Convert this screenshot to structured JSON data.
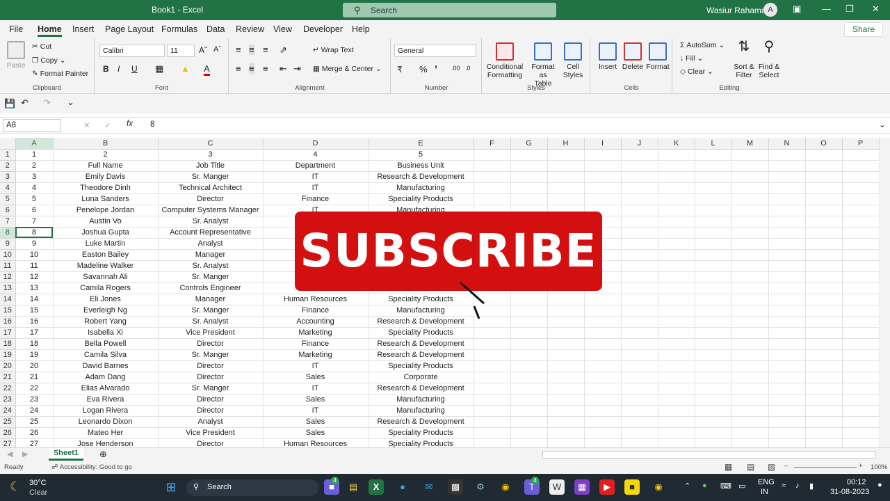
{
  "window": {
    "title": "Book1  -  Excel",
    "search_label": "Search",
    "user_name": "Wasiur Rahaman",
    "avatar_initials": "A"
  },
  "menu": {
    "tabs": [
      "File",
      "Home",
      "Insert",
      "Page Layout",
      "Formulas",
      "Data",
      "Review",
      "View",
      "Developer",
      "Help"
    ],
    "share": "Share"
  },
  "ribbon": {
    "clipboard": {
      "paste": "Paste",
      "cut": "Cut",
      "copy": "Copy",
      "format_painter": "Format Painter",
      "label": "Clipboard"
    },
    "font": {
      "name": "Calibri",
      "size": "11",
      "label": "Font"
    },
    "alignment": {
      "wrap": "Wrap Text",
      "merge": "Merge & Center",
      "label": "Alignment"
    },
    "number": {
      "format": "General",
      "label": "Number"
    },
    "styles": {
      "cond": "Conditional",
      "cond2": "Formatting",
      "fmt": "Format as",
      "fmt2": "Table",
      "cell": "Cell",
      "cell2": "Styles",
      "label": "Styles"
    },
    "cells": {
      "insert": "Insert",
      "delete": "Delete",
      "format": "Format",
      "label": "Cells"
    },
    "editing": {
      "autosum": "AutoSum",
      "fill": "Fill",
      "clear": "Clear",
      "sort": "Sort &",
      "sort2": "Filter",
      "find": "Find &",
      "find2": "Select",
      "label": "Editing"
    }
  },
  "formula_bar": {
    "name_box": "A8",
    "value": "8"
  },
  "columns": [
    "A",
    "B",
    "C",
    "D",
    "E",
    "F",
    "G",
    "H",
    "I",
    "J",
    "K",
    "L",
    "M",
    "N",
    "O",
    "P"
  ],
  "rows": [
    [
      "1",
      "1",
      "2",
      "3",
      "4",
      "5"
    ],
    [
      "2",
      "2",
      "Full Name",
      "Job Title",
      "Department",
      "Business Unit"
    ],
    [
      "3",
      "3",
      "Emily Davis",
      "Sr. Manger",
      "IT",
      "Research & Development"
    ],
    [
      "4",
      "4",
      "Theodore Dinh",
      "Technical Architect",
      "IT",
      "Manufacturing"
    ],
    [
      "5",
      "5",
      "Luna Sanders",
      "Director",
      "Finance",
      "Speciality Products"
    ],
    [
      "6",
      "6",
      "Penelope Jordan",
      "Computer Systems Manager",
      "IT",
      "Manufacturing"
    ],
    [
      "7",
      "7",
      "Austin Vo",
      "Sr. Analyst",
      "",
      ""
    ],
    [
      "8",
      "8",
      "Joshua Gupta",
      "Account Representative",
      "",
      ""
    ],
    [
      "9",
      "9",
      "Luke Martin",
      "Analyst",
      "",
      ""
    ],
    [
      "10",
      "10",
      "Easton Bailey",
      "Manager",
      "",
      ""
    ],
    [
      "11",
      "11",
      "Madeline Walker",
      "Sr. Analyst",
      "",
      ""
    ],
    [
      "12",
      "12",
      "Savannah Ali",
      "Sr. Manger",
      "Hu",
      ""
    ],
    [
      "13",
      "13",
      "Camila Rogers",
      "Controls Engineer",
      "",
      ""
    ],
    [
      "14",
      "14",
      "Eli Jones",
      "Manager",
      "Human Resources",
      "Speciality Products"
    ],
    [
      "15",
      "15",
      "Everleigh Ng",
      "Sr. Manger",
      "Finance",
      "Manufacturing"
    ],
    [
      "16",
      "16",
      "Robert Yang",
      "Sr. Analyst",
      "Accounting",
      "Research & Development"
    ],
    [
      "17",
      "17",
      "Isabella Xi",
      "Vice President",
      "Marketing",
      "Speciality Products"
    ],
    [
      "18",
      "18",
      "Bella Powell",
      "Director",
      "Finance",
      "Research & Development"
    ],
    [
      "19",
      "19",
      "Camila Silva",
      "Sr. Manger",
      "Marketing",
      "Research & Development"
    ],
    [
      "20",
      "20",
      "David Barnes",
      "Director",
      "IT",
      "Speciality Products"
    ],
    [
      "21",
      "21",
      "Adam Dang",
      "Director",
      "Sales",
      "Corporate"
    ],
    [
      "22",
      "22",
      "Elias Alvarado",
      "Sr. Manger",
      "IT",
      "Research & Development"
    ],
    [
      "23",
      "23",
      "Eva Rivera",
      "Director",
      "Sales",
      "Manufacturing"
    ],
    [
      "24",
      "24",
      "Logan Rivera",
      "Director",
      "IT",
      "Manufacturing"
    ],
    [
      "25",
      "25",
      "Leonardo Dixon",
      "Analyst",
      "Sales",
      "Research & Development"
    ],
    [
      "26",
      "26",
      "Mateo Her",
      "Vice President",
      "Sales",
      "Speciality Products"
    ],
    [
      "27",
      "27",
      "Jose Henderson",
      "Director",
      "Human Resources",
      "Speciality Products"
    ]
  ],
  "sheet": {
    "tab": "Sheet1"
  },
  "status": {
    "ready": "Ready",
    "accessibility": "Accessibility: Good to go",
    "zoom": "100%"
  },
  "overlay": {
    "text": "SUBSCRIBE"
  },
  "taskbar": {
    "temp": "30°C",
    "weather": "Clear",
    "search": "Search",
    "lang1": "ENG",
    "lang2": "IN",
    "time": "00:12",
    "date": "31-08-2023",
    "badge_teams": "4",
    "badge_chat": "4"
  }
}
